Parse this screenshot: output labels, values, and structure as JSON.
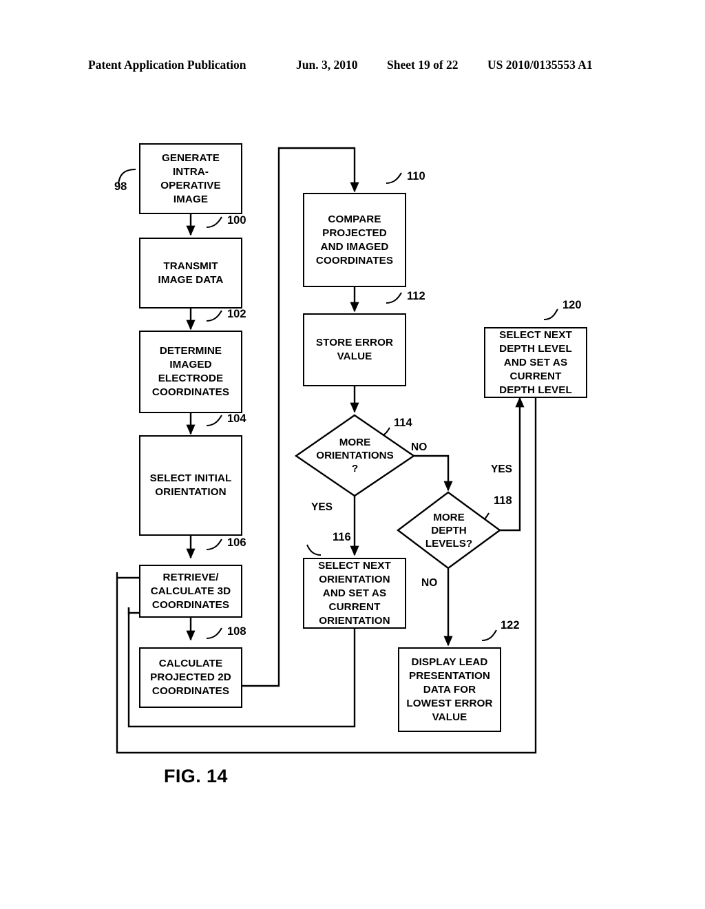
{
  "header": {
    "publication": "Patent Application Publication",
    "date": "Jun. 3, 2010",
    "sheet": "Sheet 19 of 22",
    "doc_number": "US 2010/0135553 A1"
  },
  "figure": {
    "caption": "FIG. 14",
    "ink_color": "#000000",
    "background_color": "#ffffff"
  },
  "nodes": {
    "n98": {
      "ref": "98",
      "label": "GENERATE INTRA-OPERATIVE IMAGE",
      "shape": "process"
    },
    "n100": {
      "ref": "100",
      "label": "TRANSMIT IMAGE DATA",
      "shape": "process"
    },
    "n102": {
      "ref": "102",
      "label": "DETERMINE IMAGED ELECTRODE COORDINATES",
      "shape": "process"
    },
    "n104": {
      "ref": "104",
      "label": "SELECT INITIAL ORIENTATION",
      "shape": "process"
    },
    "n106": {
      "ref": "106",
      "label": "RETRIEVE/ CALCULATE 3D COORDINATES",
      "shape": "process"
    },
    "n108": {
      "ref": "108",
      "label": "CALCULATE PROJECTED 2D COORDINATES",
      "shape": "process"
    },
    "n110": {
      "ref": "110",
      "label": "COMPARE PROJECTED AND IMAGED COORDINATES",
      "shape": "process"
    },
    "n112": {
      "ref": "112",
      "label": "STORE ERROR VALUE",
      "shape": "process"
    },
    "n114": {
      "ref": "114",
      "label": "MORE ORIENTATIONS ?",
      "shape": "decision"
    },
    "n116": {
      "ref": "116",
      "label": "SELECT NEXT ORIENTATION AND SET AS CURRENT ORIENTATION",
      "shape": "process"
    },
    "n118": {
      "ref": "118",
      "label": "MORE DEPTH LEVELS?",
      "shape": "decision"
    },
    "n120": {
      "ref": "120",
      "label": "SELECT NEXT DEPTH LEVEL AND SET AS CURRENT DEPTH LEVEL",
      "shape": "process"
    },
    "n122": {
      "ref": "122",
      "label": "DISPLAY LEAD PRESENTATION DATA FOR LOWEST ERROR VALUE",
      "shape": "process"
    }
  },
  "node_lines": {
    "n98": [
      "GENERATE",
      "INTRA-",
      "OPERATIVE",
      "IMAGE"
    ],
    "n100": [
      "TRANSMIT",
      "IMAGE DATA"
    ],
    "n102": [
      "DETERMINE",
      "IMAGED",
      "ELECTRODE",
      "COORDINATES"
    ],
    "n104": [
      "SELECT INITIAL",
      "ORIENTATION"
    ],
    "n106": [
      "RETRIEVE/",
      "CALCULATE 3D",
      "COORDINATES"
    ],
    "n108": [
      "CALCULATE",
      "PROJECTED 2D",
      "COORDINATES"
    ],
    "n110": [
      "COMPARE",
      "PROJECTED",
      "AND IMAGED",
      "COORDINATES"
    ],
    "n112": [
      "STORE ERROR",
      "VALUE"
    ],
    "n114": [
      "MORE",
      "ORIENTATIONS",
      "?"
    ],
    "n116": [
      "SELECT NEXT",
      "ORIENTATION",
      "AND SET AS",
      "CURRENT",
      "ORIENTATION"
    ],
    "n118": [
      "MORE",
      "DEPTH",
      "LEVELS?"
    ],
    "n120": [
      "SELECT NEXT",
      "DEPTH LEVEL",
      "AND SET AS",
      "CURRENT",
      "DEPTH LEVEL"
    ],
    "n122": [
      "DISPLAY LEAD",
      "PRESENTATION",
      "DATA FOR",
      "LOWEST ERROR",
      "VALUE"
    ]
  },
  "edge_labels": {
    "orientations_no": "NO",
    "orientations_yes": "YES",
    "depth_yes": "YES",
    "depth_no": "NO"
  }
}
